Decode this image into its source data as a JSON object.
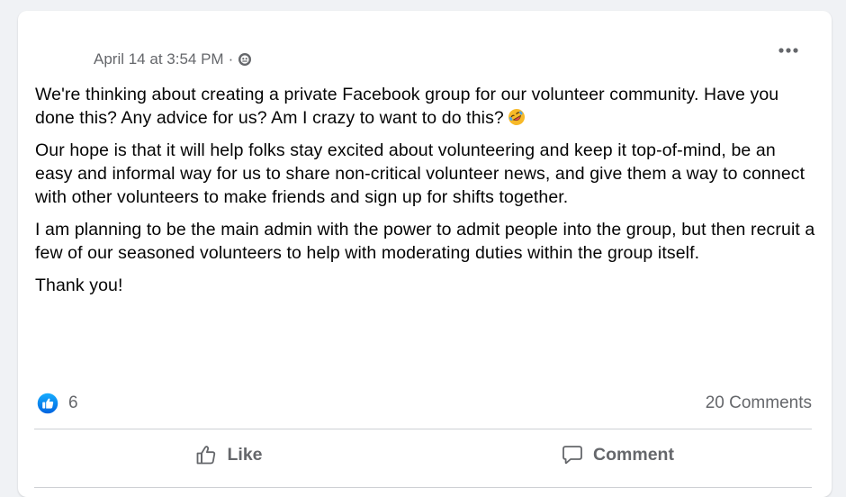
{
  "post": {
    "timestamp": "April 14 at 3:54 PM",
    "separator": "·",
    "audience_icon": "globe-icon",
    "paragraphs": [
      "We're thinking about creating a private Facebook group for our volunteer community. Have you done this? Any advice for us? Am I crazy to want to do this?",
      "Our hope is that it will help folks stay excited about volunteering and keep it top-of-mind, be an easy and informal way for us to share non-critical volunteer news, and give them a way to connect with other volunteers to make friends and sign up for shifts together.",
      "I am planning to be the main admin with the power to admit people into the group, but then recruit a few of our seasoned volunteers to help with moderating duties within the group itself.",
      "Thank you!"
    ],
    "emoji": "rolling-on-floor-laughing-emoji"
  },
  "footer": {
    "reaction_count": "6",
    "reaction_icon": "like-reaction-icon",
    "comments_count": "20 Comments"
  },
  "actions": {
    "like_label": "Like",
    "comment_label": "Comment"
  },
  "colors": {
    "accent": "#1877f2",
    "secondary_text": "#65676b",
    "divider": "#ced0d4",
    "background": "#f0f2f5"
  }
}
